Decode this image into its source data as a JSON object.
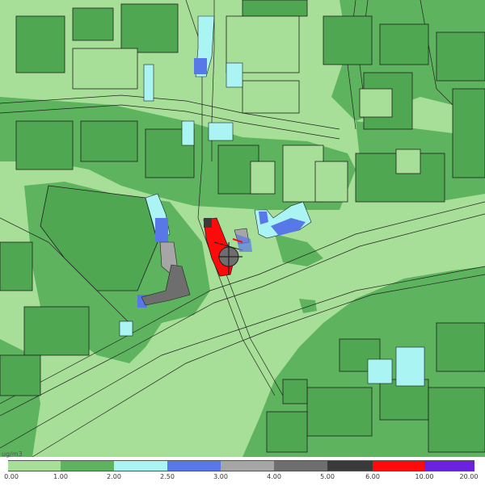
{
  "legend": {
    "unit": "ug/m3",
    "ticks": [
      "0.00",
      "1.00",
      "2.00",
      "2.50",
      "3.00",
      "4.00",
      "5.00",
      "6.00",
      "10.00",
      "20.00"
    ],
    "colors": [
      "#a8df98",
      "#5db35e",
      "#aaf4f4",
      "#5878e8",
      "#a6a6a6",
      "#6e6e6e",
      "#3a3a3a",
      "#ff0a0a",
      "#6a22e0"
    ]
  },
  "map_colors": {
    "background": "#a8df98",
    "zone_dark": "#5db35e",
    "building_light": "#a8df98",
    "building_dark": "#4fa752",
    "outline": "#202020"
  }
}
